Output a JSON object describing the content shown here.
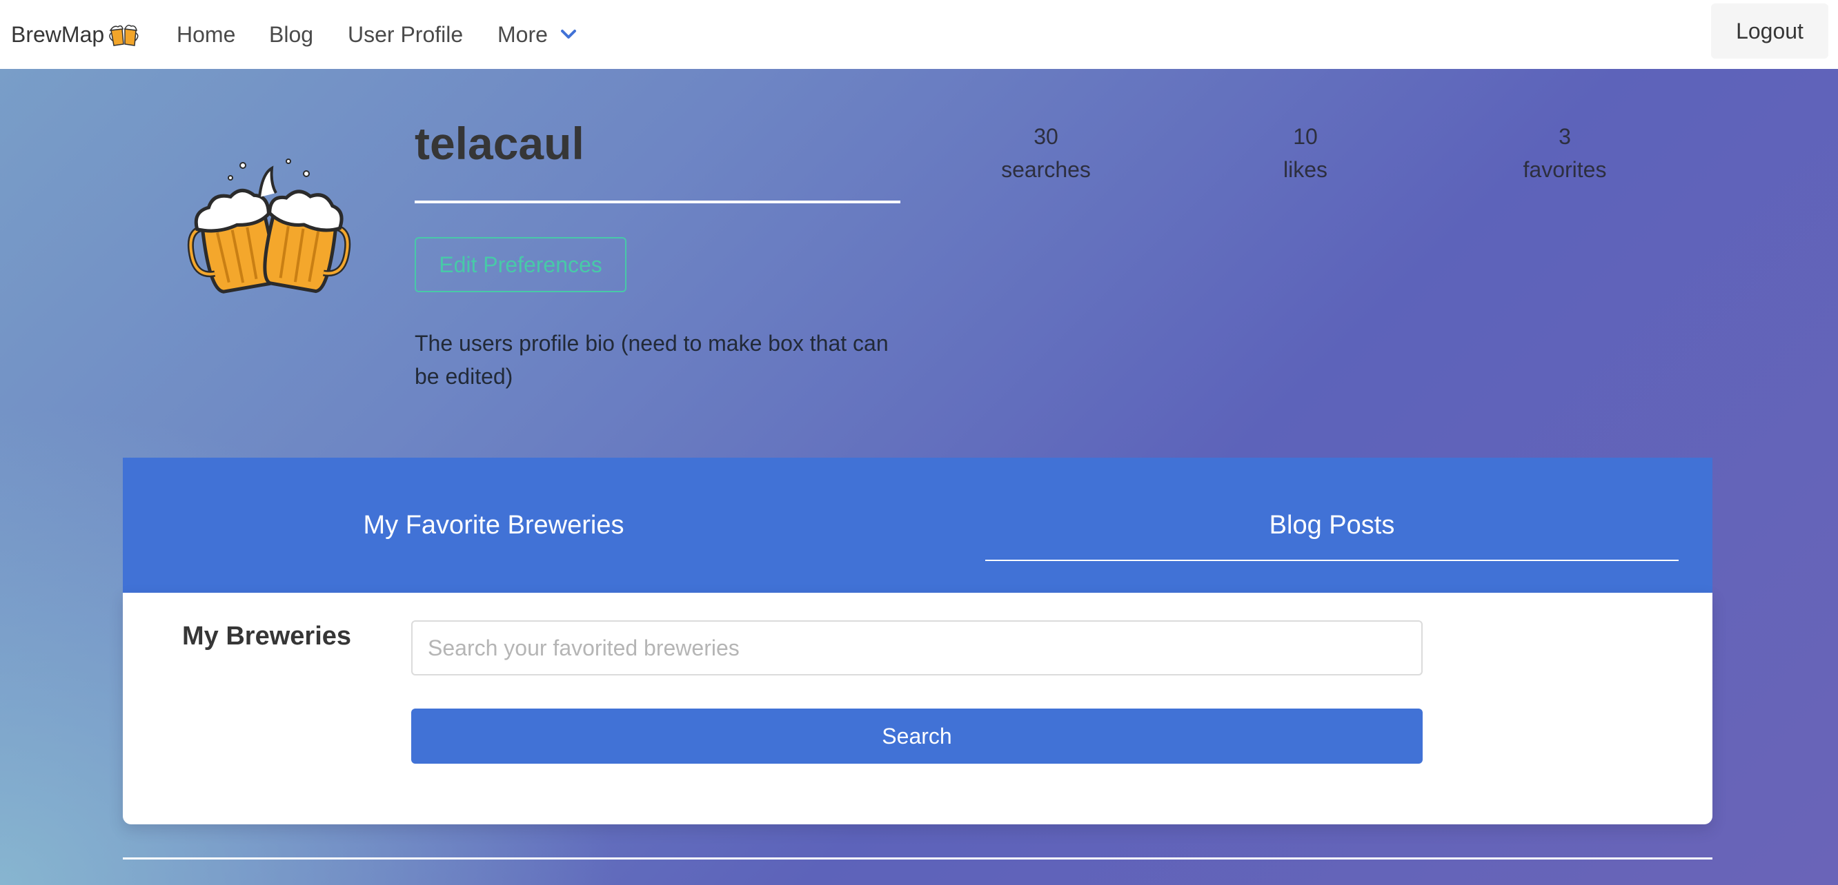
{
  "navbar": {
    "brand": "BrewMap",
    "brand_icon": "beer-mugs-icon",
    "links": [
      "Home",
      "Blog",
      "User Profile"
    ],
    "more_label": "More",
    "logout_label": "Logout"
  },
  "profile": {
    "avatar_icon": "beer-mugs-toast-icon",
    "username": "telacaul",
    "edit_label": "Edit Preferences",
    "bio": "The users profile bio (need to make box that can be edited)",
    "stats": [
      {
        "value": "30",
        "label": "searches"
      },
      {
        "value": "10",
        "label": "likes"
      },
      {
        "value": "3",
        "label": "favorites"
      }
    ]
  },
  "tabs": {
    "favorites": "My Favorite Breweries",
    "blog": "Blog Posts",
    "active": "blog"
  },
  "breweries": {
    "title": "My Breweries",
    "search_placeholder": "Search your favorited breweries",
    "search_value": "",
    "search_button": "Search"
  },
  "colors": {
    "primary": "#4172d6",
    "accent": "#48c9a8"
  }
}
